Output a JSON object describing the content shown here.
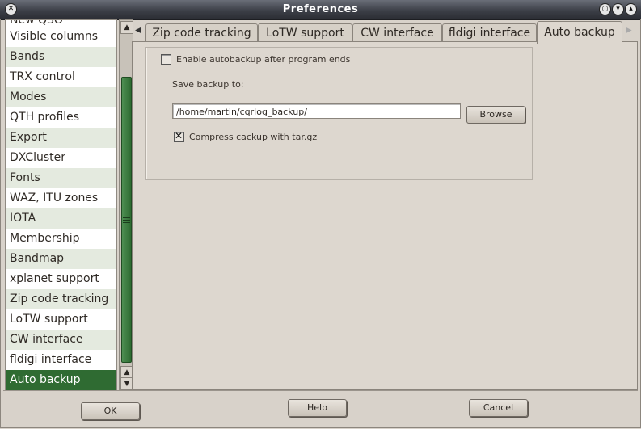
{
  "window": {
    "title": "Preferences"
  },
  "sidebar": {
    "clipped_item": "New QSO",
    "items": [
      {
        "label": "Visible columns"
      },
      {
        "label": "Bands"
      },
      {
        "label": "TRX control"
      },
      {
        "label": "Modes"
      },
      {
        "label": "QTH profiles"
      },
      {
        "label": "Export"
      },
      {
        "label": "DXCluster"
      },
      {
        "label": "Fonts"
      },
      {
        "label": "WAZ, ITU zones"
      },
      {
        "label": "IOTA"
      },
      {
        "label": "Membership"
      },
      {
        "label": "Bandmap"
      },
      {
        "label": "xplanet support"
      },
      {
        "label": "Zip code tracking"
      },
      {
        "label": "LoTW support"
      },
      {
        "label": "CW interface"
      },
      {
        "label": "fldigi interface"
      },
      {
        "label": "Auto backup"
      }
    ],
    "selected": "Auto backup"
  },
  "tabs": [
    {
      "label": "Zip code tracking"
    },
    {
      "label": "LoTW support"
    },
    {
      "label": "CW interface"
    },
    {
      "label": "fldigi interface"
    },
    {
      "label": "Auto backup"
    }
  ],
  "auto_backup": {
    "enable_label": "Enable autobackup after program ends",
    "enable_checked": false,
    "save_to_label": "Save backup to:",
    "path_value": "/home/martin/cqrlog_backup/",
    "browse_label": "Browse",
    "compress_label": "Compress cackup with tar.gz",
    "compress_checked": true
  },
  "footer": {
    "ok": "OK",
    "help": "Help",
    "cancel": "Cancel"
  },
  "colors": {
    "selection": "#2f6b32",
    "alt_row": "#e4eadf",
    "titlebar": "#3c3f47"
  }
}
